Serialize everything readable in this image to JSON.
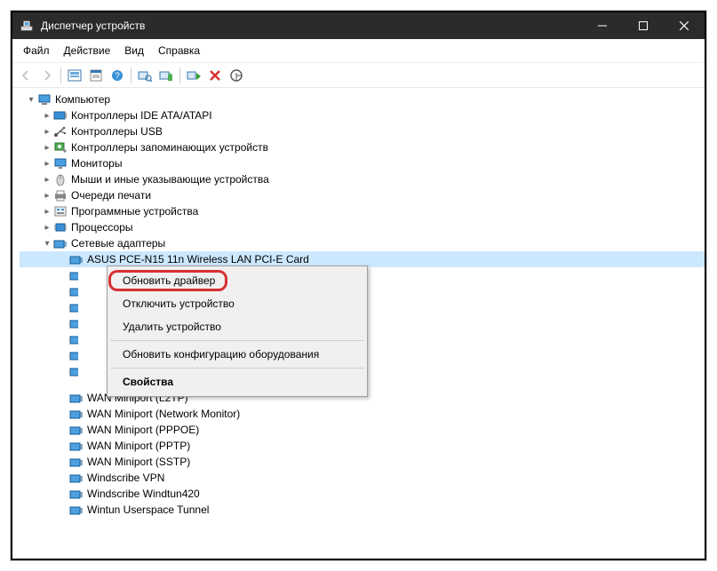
{
  "title": "Диспетчер устройств",
  "menus": [
    "Файл",
    "Действие",
    "Вид",
    "Справка"
  ],
  "tree": {
    "root": "Компьютер",
    "categories": [
      "Контроллеры IDE ATA/ATAPI",
      "Контроллеры USB",
      "Контроллеры запоминающих устройств",
      "Мониторы",
      "Мыши и иные указывающие устройства",
      "Очереди печати",
      "Программные устройства",
      "Процессоры"
    ],
    "expanded_label": "Сетевые адаптеры",
    "selected_device": "ASUS PCE-N15 11n Wireless LAN PCI-E Card",
    "tail": [
      "WAN Miniport (L2TP)",
      "WAN Miniport (Network Monitor)",
      "WAN Miniport (PPPOE)",
      "WAN Miniport (PPTP)",
      "WAN Miniport (SSTP)",
      "Windscribe VPN",
      "Windscribe Windtun420",
      "Wintun Userspace Tunnel"
    ]
  },
  "context_menu": {
    "items": [
      "Обновить драйвер",
      "Отключить устройство",
      "Удалить устройство"
    ],
    "sep_item": "Обновить конфигурацию оборудования",
    "props": "Свойства"
  }
}
